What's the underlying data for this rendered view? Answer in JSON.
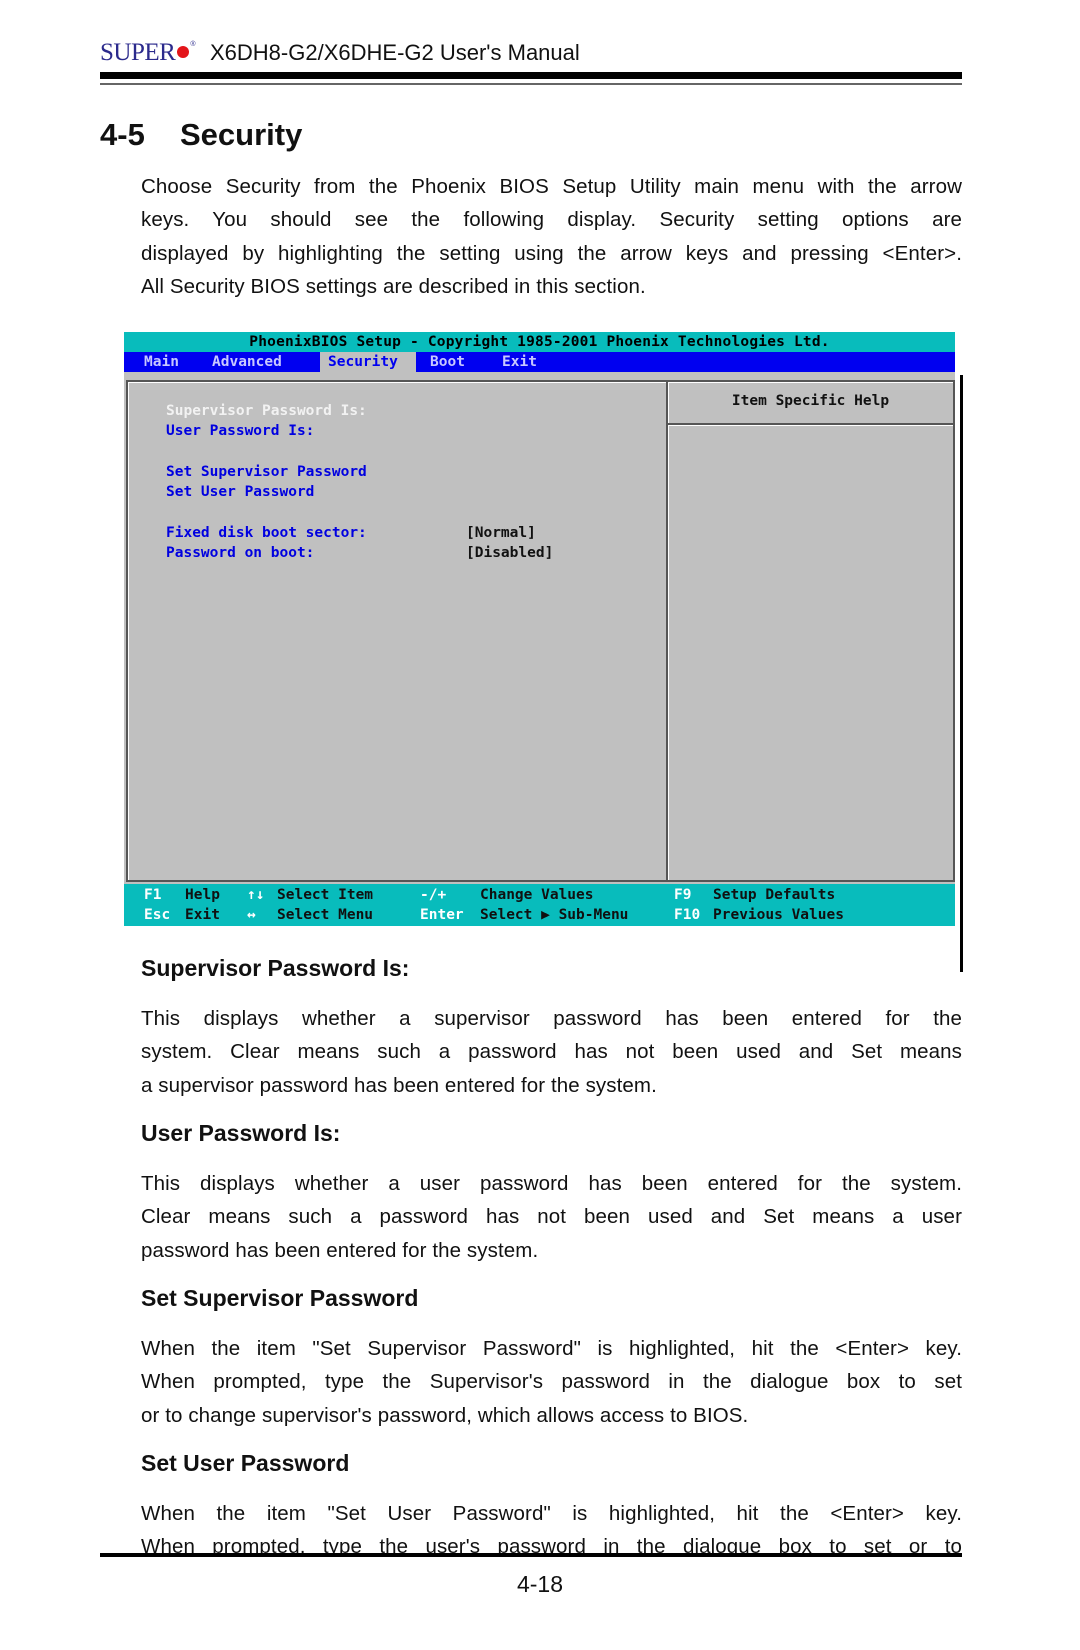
{
  "header": {
    "brand": "SUPER",
    "manual_title": "X6DH8-G2/X6DHE-G2 User's Manual"
  },
  "section": {
    "number": "4-5",
    "title": "Security",
    "intro_lines": [
      "Choose Security from the Phoenix BIOS Setup Utility main menu with the arrow",
      "keys.  You should see the following display.  Security setting options are",
      "displayed by highlighting the setting using the arrow keys and pressing <Enter>.",
      "All Security BIOS settings are described in this section."
    ]
  },
  "bios": {
    "title": "PhoenixBIOS Setup - Copyright 1985-2001 Phoenix Technologies Ltd.",
    "menu": [
      {
        "label": "Main",
        "active": false
      },
      {
        "label": "Advanced",
        "active": false
      },
      {
        "label": "Security",
        "active": true
      },
      {
        "label": "Boot",
        "active": false
      },
      {
        "label": "Exit",
        "active": false
      }
    ],
    "items": [
      {
        "label": "Supervisor Password Is:",
        "value": ""
      },
      {
        "label": "User Password Is:",
        "value": ""
      },
      {
        "label": "Set Supervisor Password",
        "value": ""
      },
      {
        "label": "Set User Password",
        "value": ""
      },
      {
        "label": "Fixed disk boot sector:",
        "value": "[Normal]"
      },
      {
        "label": "Password on boot:",
        "value": "[Disabled]"
      }
    ],
    "help_title": "Item Specific Help",
    "footer": {
      "row1": [
        {
          "key": "F1",
          "desc": "Help"
        },
        {
          "key": "↑↓",
          "desc": "Select Item"
        },
        {
          "key": "-/+",
          "desc": "Change Values"
        },
        {
          "key": "F9",
          "desc": "Setup Defaults"
        }
      ],
      "row2": [
        {
          "key": "Esc",
          "desc": "Exit"
        },
        {
          "key": "↔",
          "desc": "Select Menu"
        },
        {
          "key": "Enter",
          "desc": "Select ▶ Sub-Menu"
        },
        {
          "key": "F10",
          "desc": "Previous Values"
        }
      ]
    },
    "colors": {
      "title_bar": "#08bcbc",
      "menu_bar": "#0000f0",
      "panel": "#c0c0c0",
      "item_text": "#0000e0"
    }
  },
  "subsections": [
    {
      "heading": "Supervisor Password Is:",
      "lines": [
        "This displays whether a supervisor password has been entered for the",
        "system.  Clear means such a password has not been used and Set means",
        "a supervisor password has been entered for the system."
      ]
    },
    {
      "heading": "User Password Is:",
      "lines": [
        "This displays whether a user password has been entered for the system.",
        "Clear means such a password has not been used and Set means a user",
        "password has been entered for the system."
      ]
    },
    {
      "heading": "Set Supervisor Password",
      "lines": [
        "When the item \"Set Supervisor Password\" is highlighted, hit the <Enter> key.",
        "When prompted,  type the Supervisor's password in the dialogue box to set",
        "or to change supervisor's password, which allows access to BIOS."
      ]
    },
    {
      "heading": "Set User Password",
      "lines": [
        "When the item \"Set User Password\" is highlighted, hit the <Enter> key.",
        "When prompted,  type the user's password in the dialogue box to set or to"
      ]
    }
  ],
  "page_number": "4-18"
}
